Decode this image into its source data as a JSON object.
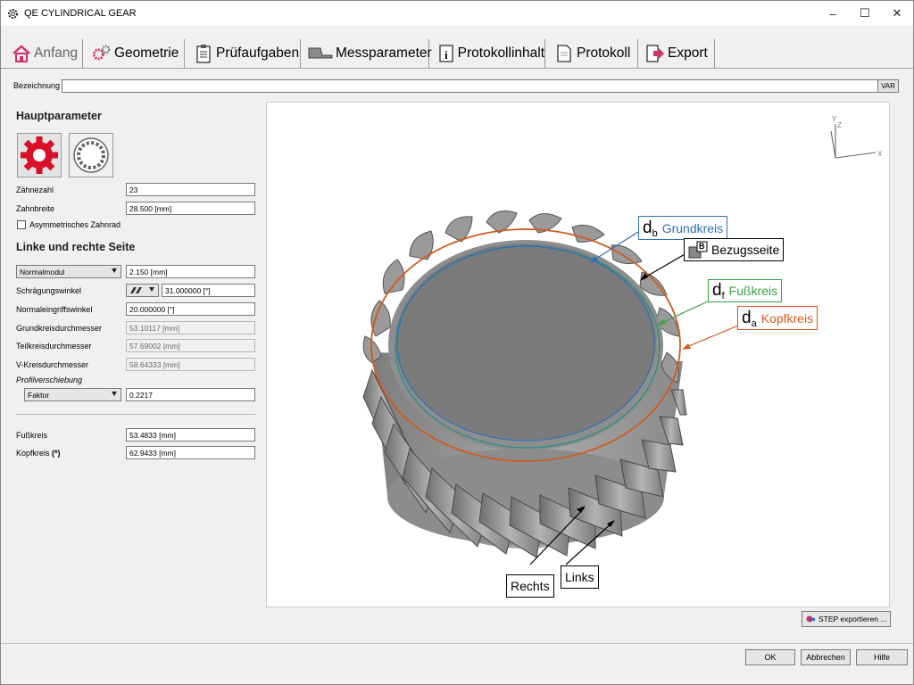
{
  "window": {
    "title": "QE CYLINDRICAL GEAR",
    "minimize": "–",
    "maximize": "☐",
    "close": "✕"
  },
  "tabs": [
    {
      "label": "Anfang",
      "icon": "home-icon"
    },
    {
      "label": "Geometrie",
      "icon": "gears-icon"
    },
    {
      "label": "Prüfaufgaben",
      "icon": "clipboard-icon"
    },
    {
      "label": "Messparameter",
      "icon": "probe-icon"
    },
    {
      "label": "Protokollinhalt",
      "icon": "info-doc-icon"
    },
    {
      "label": "Protokoll",
      "icon": "document-icon"
    },
    {
      "label": "Export",
      "icon": "export-icon"
    }
  ],
  "bezeichnung": {
    "label": "Bezeichnung",
    "value": "",
    "var_button": "VAR"
  },
  "hauptparameter": {
    "title": "Hauptparameter",
    "gear_types": [
      "external-gear-icon",
      "internal-gear-icon"
    ],
    "zaehnezahl": {
      "label": "Zähnezahl",
      "value": "23"
    },
    "zahnbreite": {
      "label": "Zahnbreite",
      "value": "28.500 [mm]"
    },
    "asym": {
      "label": "Asymmetrisches Zahnrad",
      "checked": false
    }
  },
  "seite": {
    "title": "Linke und rechte Seite",
    "modul_select": "Normalmodul",
    "modul_value": "2.150 [mm]",
    "schraeg": {
      "label": "Schrägungswinkel",
      "value": "31.000000 [°]"
    },
    "normaleingriff": {
      "label": "Normaleingriffswinkel",
      "value": "20.000000 [°]"
    },
    "grundkreis": {
      "label": "Grundkreisdurchmesser",
      "value": "53.10117 [mm]"
    },
    "teilkreis": {
      "label": "Teilkreisdurchmesser",
      "value": "57.69002 [mm]"
    },
    "vkreis": {
      "label": "V-Kreisdurchmesser",
      "value": "58.64333 [mm]"
    },
    "profil": {
      "label": "Profilverschiebung",
      "select": "Faktor",
      "value": "0.2217"
    }
  },
  "fuss": {
    "label": "Fußkreis",
    "value": "53.4833 [mm]"
  },
  "kopf": {
    "label": "Kopfkreis",
    "marker": "(*)",
    "value": "62.9433 [mm]"
  },
  "viewport": {
    "axes": {
      "y": "Y",
      "z": "Z",
      "x": "X"
    },
    "callouts": {
      "grundkreis": {
        "sym": "d",
        "sub": "b",
        "text": "Grundkreis",
        "color": "#2f6fb7"
      },
      "bezugsseite": {
        "badge": "B",
        "text": "Bezugsseite",
        "color": "#000000"
      },
      "fusskreis": {
        "sym": "d",
        "sub": "f",
        "text": "Fußkreis",
        "color": "#3aa043"
      },
      "kopfkreis": {
        "sym": "d",
        "sub": "a",
        "text": "Kopfkreis",
        "color": "#d05a1f"
      },
      "rechts": {
        "text": "Rechts"
      },
      "links": {
        "text": "Links"
      }
    }
  },
  "step_button": "STEP exportieren ...",
  "buttons": {
    "ok": "OK",
    "cancel": "Abbrechen",
    "help": "Hilfe"
  }
}
